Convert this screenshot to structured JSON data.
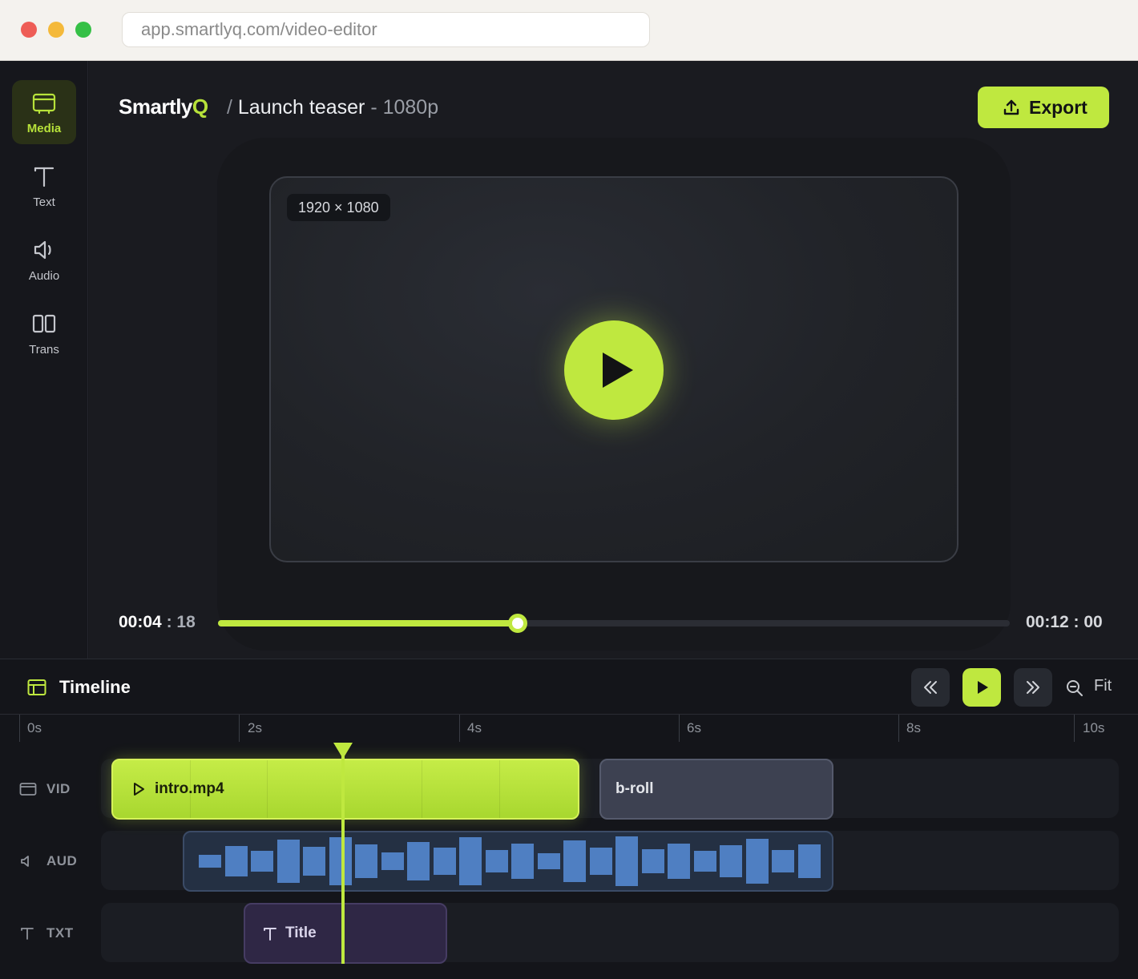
{
  "browser": {
    "url": "app.smartlyq.com/video-editor"
  },
  "sidebar": {
    "items": [
      {
        "label": "Media",
        "icon": "media-icon",
        "active": true
      },
      {
        "label": "Text",
        "icon": "text-icon",
        "active": false
      },
      {
        "label": "Audio",
        "icon": "audio-icon",
        "active": false
      },
      {
        "label": "Trans",
        "icon": "transitions-icon",
        "active": false
      }
    ]
  },
  "header": {
    "brand_main": "Smartly",
    "brand_accent": "Q",
    "separator": "/",
    "project_title": "Launch teaser",
    "resolution": "- 1080p",
    "export_label": "Export"
  },
  "preview": {
    "resolution_badge": "1920 × 1080",
    "play_icon": "play-icon"
  },
  "playback": {
    "current_time": "00:04",
    "current_frame": ": 18",
    "total_time": "00:12 : 00",
    "progress": 0.379
  },
  "timeline": {
    "title": "Timeline",
    "zoom_label": "Fit",
    "ruler": [
      "0s",
      "2s",
      "4s",
      "6s",
      "8s",
      "10s"
    ],
    "tracks": [
      {
        "label": "VID",
        "icon": "video-track-icon"
      },
      {
        "label": "AUD",
        "icon": "audio-track-icon"
      },
      {
        "label": "TXT",
        "icon": "text-track-icon"
      }
    ],
    "clips": {
      "video_main": "intro.mp4",
      "video_second": "b-roll",
      "text": "Title"
    }
  },
  "colors": {
    "accent": "#bfe83f",
    "audio_wave": "#4f7fc2",
    "text_clip": "#2f2745"
  }
}
